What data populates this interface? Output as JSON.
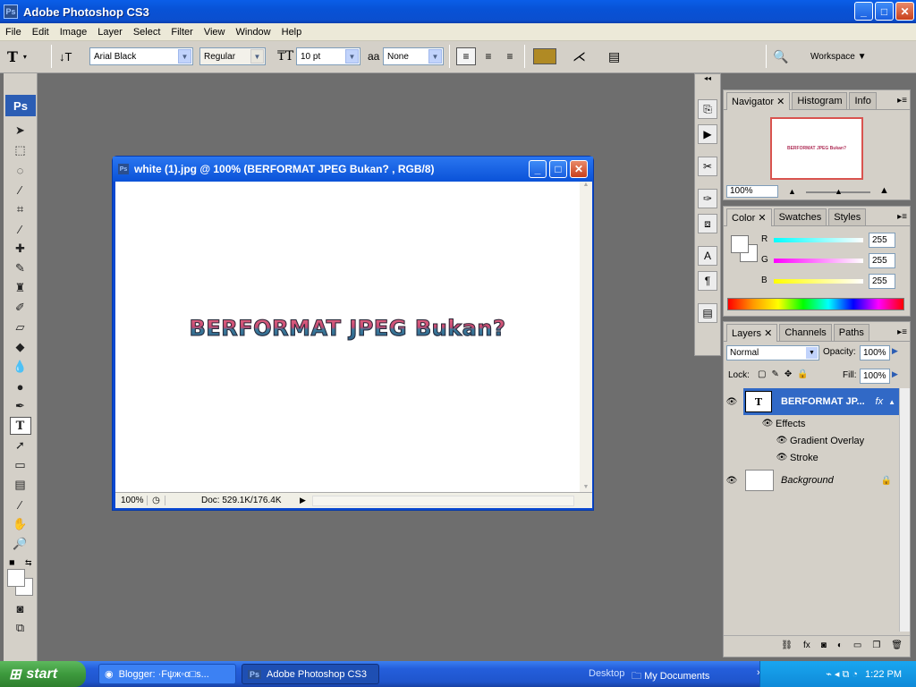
{
  "app": {
    "title": "Adobe Photoshop CS3",
    "icon": "ps-app-icon"
  },
  "window_controls": {
    "minimize": "_",
    "maximize": "□",
    "close": "✕"
  },
  "menu": [
    "File",
    "Edit",
    "Image",
    "Layer",
    "Select",
    "Filter",
    "View",
    "Window",
    "Help"
  ],
  "options": {
    "font_family": "Arial Black",
    "font_style": "Regular",
    "font_size": "10 pt",
    "antialias_label": "aa",
    "antialias": "None",
    "text_color": "#b08a24",
    "workspace": "Workspace ▼"
  },
  "document": {
    "title": "white (1).jpg @ 100% (BERFORMAT JPEG Bukan? , RGB/8)",
    "canvas_text": "BERFORMAT JPEG Bukan?",
    "zoom": "100%",
    "doc_info": "Doc: 529.1K/176.4K"
  },
  "navigator": {
    "tabs": [
      "Navigator",
      "Histogram",
      "Info"
    ],
    "thumbnail_text": "BERFORMAT JPEG Bukan?",
    "zoom": "100%"
  },
  "color": {
    "tabs": [
      "Color",
      "Swatches",
      "Styles"
    ],
    "channels": [
      {
        "label": "R",
        "value": "255"
      },
      {
        "label": "G",
        "value": "255"
      },
      {
        "label": "B",
        "value": "255"
      }
    ]
  },
  "layers": {
    "tabs": [
      "Layers",
      "Channels",
      "Paths"
    ],
    "blend_mode": "Normal",
    "opacity_label": "Opacity:",
    "opacity": "100%",
    "lock_label": "Lock:",
    "fill_label": "Fill:",
    "fill": "100%",
    "items": [
      {
        "name": "BERFORMAT JP...",
        "thumb": "T",
        "fx": "fx",
        "selected": true
      },
      {
        "name": "Effects"
      },
      {
        "name": "Gradient Overlay"
      },
      {
        "name": "Stroke"
      },
      {
        "name": "Background",
        "locked": true
      }
    ]
  },
  "taskbar": {
    "start": "start",
    "tasks": [
      "Blogger: ·Fψж◦α□s...",
      "Adobe Photoshop CS3"
    ],
    "desktop": "Desktop",
    "my_documents": "My Documents",
    "time": "1:22 PM"
  }
}
